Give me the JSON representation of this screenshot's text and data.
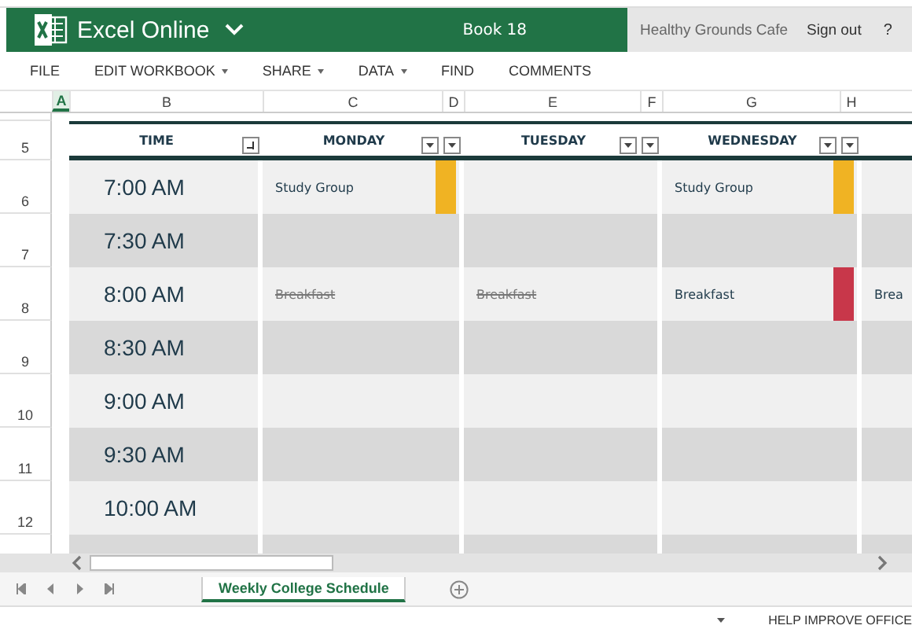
{
  "app": {
    "name": "Excel Online",
    "document": "Book 18",
    "account": "Healthy Grounds Cafe",
    "sign_out": "Sign out",
    "help": "?"
  },
  "menu": [
    {
      "label": "FILE",
      "dropdown": false
    },
    {
      "label": "EDIT WORKBOOK",
      "dropdown": true
    },
    {
      "label": "SHARE",
      "dropdown": true
    },
    {
      "label": "DATA",
      "dropdown": true
    },
    {
      "label": "FIND",
      "dropdown": false
    },
    {
      "label": "COMMENTS",
      "dropdown": false
    }
  ],
  "column_headers": [
    {
      "label": "A",
      "selected": true
    },
    {
      "label": "B",
      "selected": false
    },
    {
      "label": "C",
      "selected": false
    },
    {
      "label": "D",
      "selected": false
    },
    {
      "label": "E",
      "selected": false
    },
    {
      "label": "F",
      "selected": false
    },
    {
      "label": "G",
      "selected": false
    },
    {
      "label": "H",
      "selected": false
    }
  ],
  "header_row": {
    "row_number": "5",
    "time": "TIME",
    "days": [
      "MONDAY",
      "TUESDAY",
      "WEDNESDAY"
    ]
  },
  "rows": [
    {
      "row_number": "6",
      "time": "7:00 AM",
      "cells": [
        {
          "text": "Study Group",
          "done": false,
          "color": "#f0b323"
        },
        {},
        {
          "text": "Study Group",
          "done": false,
          "color": "#f0b323"
        },
        {}
      ]
    },
    {
      "row_number": "7",
      "time": "7:30 AM",
      "cells": [
        {},
        {},
        {},
        {}
      ]
    },
    {
      "row_number": "8",
      "time": "8:00 AM",
      "cells": [
        {
          "text": "Breakfast",
          "done": true
        },
        {
          "text": "Breakfast",
          "done": true
        },
        {
          "text": "Breakfast",
          "done": false,
          "color": "#c8374a"
        },
        {
          "text": "Brea",
          "done": false
        }
      ]
    },
    {
      "row_number": "9",
      "time": "8:30 AM",
      "cells": [
        {},
        {},
        {},
        {}
      ]
    },
    {
      "row_number": "10",
      "time": "9:00 AM",
      "cells": [
        {},
        {},
        {},
        {}
      ]
    },
    {
      "row_number": "11",
      "time": "9:30 AM",
      "cells": [
        {},
        {},
        {},
        {}
      ]
    },
    {
      "row_number": "12",
      "time": "10:00 AM",
      "cells": [
        {},
        {},
        {},
        {}
      ]
    }
  ],
  "sheet_tabs": [
    {
      "label": "Weekly College Schedule",
      "selected": true
    }
  ],
  "status_bar": {
    "help": "HELP IMPROVE OFFICE"
  }
}
